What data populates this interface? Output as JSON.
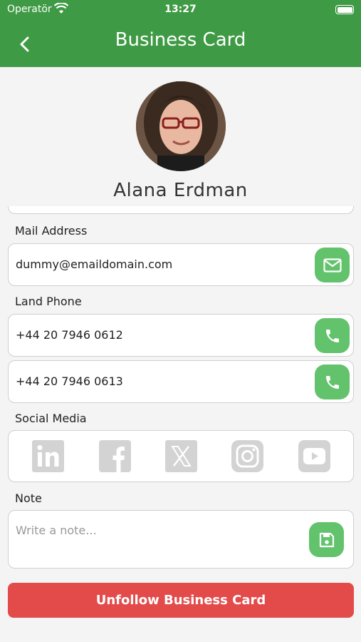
{
  "status": {
    "carrier": "Operatör",
    "time": "13:27"
  },
  "header": {
    "title": "Business Card"
  },
  "profile": {
    "name": "Alana Erdman"
  },
  "mail": {
    "label": "Mail Address",
    "value": "dummy@emaildomain.com"
  },
  "land_phone": {
    "label": "Land Phone",
    "numbers": [
      "+44 20 7946 0612",
      "+44 20 7946 0613"
    ]
  },
  "social": {
    "label": "Social Media",
    "icons": [
      "linkedin-icon",
      "facebook-icon",
      "x-icon",
      "instagram-icon",
      "youtube-icon"
    ]
  },
  "note": {
    "label": "Note",
    "placeholder": "Write a note..."
  },
  "unfollow_label": "Unfollow Business Card",
  "colors": {
    "primary": "#3f9a45",
    "button": "#63c26c",
    "danger": "#e24b4a",
    "icon_gray": "#d3d3d3"
  }
}
